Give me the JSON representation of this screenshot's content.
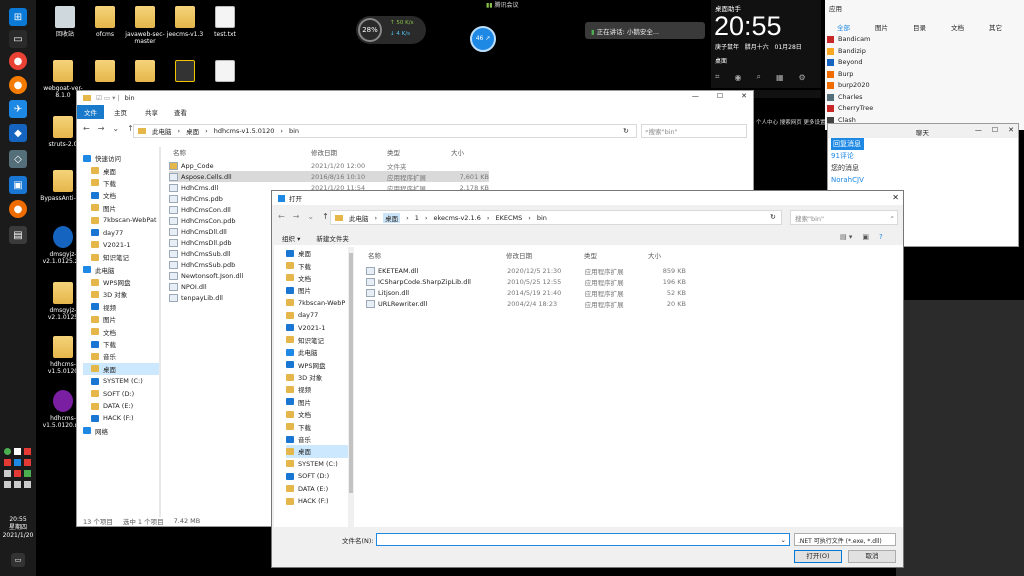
{
  "desktop": {
    "icons": [
      {
        "label": "回收站"
      },
      {
        "label": "ofcms"
      },
      {
        "label": "javaweb-sec-master"
      },
      {
        "label": "jeecms-v1.3"
      },
      {
        "label": "test.txt"
      },
      {
        "label": "webgoat-ver-8.1.0"
      },
      {
        "label": "struts-2.0"
      },
      {
        "label": "BypassAnti-run"
      },
      {
        "label": "dmsgyjz-v2.1.0125.zip"
      },
      {
        "label": "dmsgyjz-v2.1.0125"
      },
      {
        "label": "hdhcms-v1.5.0120"
      },
      {
        "label": "hdhcms-v1.5.0120.rar"
      }
    ]
  },
  "clock_widget": {
    "label": "桌面助手",
    "time": "20:55",
    "weekday": "庚子鼠年",
    "lunar": "腊月十六",
    "date": "01月28日",
    "app_label": "应用",
    "search_label": "设置",
    "desktop_label": "桌面"
  },
  "net_widget": {
    "percent": "28%",
    "up": "50 K/s",
    "down": "4 K/s",
    "badge": "46 ↗"
  },
  "meeting": {
    "label": "腾讯会议"
  },
  "voice": {
    "label": "正在讲话: 小鹅安全..."
  },
  "apps_panel": {
    "title": "应用",
    "tabs": [
      "全部",
      "图片",
      "目录",
      "文档",
      "其它"
    ],
    "items": [
      "Bandicam",
      "Bandizip",
      "Beyond",
      "Burp",
      "burp2020",
      "Charles",
      "CherryTree",
      "Clash"
    ]
  },
  "small_win": {
    "title": "聊天",
    "items": [
      "回复消息",
      "91评论",
      "您的消息",
      "NorahCJV"
    ]
  },
  "status_bar": {
    "hint": "个人中心 搜索网页 更多设置"
  },
  "explorer": {
    "title": "bin",
    "ribbon": [
      "文件",
      "主页",
      "共享",
      "查看"
    ],
    "path": [
      "此电脑",
      "桌面",
      "hdhcms-v1.5.0120",
      "bin"
    ],
    "search_placeholder": "搜索\"bin\"",
    "cols": [
      "名称",
      "修改日期",
      "类型",
      "大小"
    ],
    "tree": [
      "快速访问",
      "桌面",
      "下载",
      "文档",
      "图片",
      "7kbscan-WebPat",
      "day77",
      "V2021-1",
      "知识笔记",
      "此电脑",
      "WPS网盘",
      "3D 对象",
      "视频",
      "图片",
      "文档",
      "下载",
      "音乐",
      "桌面",
      "SYSTEM (C:)",
      "SOFT (D:)",
      "DATA (E:)",
      "HACK (F:)",
      "网络"
    ],
    "files": [
      {
        "name": "App_Code",
        "date": "2021/1/20 12:00",
        "type": "文件夹",
        "size": ""
      },
      {
        "name": "Aspose.Cells.dll",
        "date": "2016/8/16 10:10",
        "type": "应用程序扩展",
        "size": "7,601 KB"
      },
      {
        "name": "HdhCms.dll",
        "date": "2021/1/20 11:54",
        "type": "应用程序扩展",
        "size": "2,178 KB"
      },
      {
        "name": "HdhCms.pdb",
        "date": "",
        "type": "",
        "size": ""
      },
      {
        "name": "HdhCmsCon.dll",
        "date": "",
        "type": "",
        "size": ""
      },
      {
        "name": "HdhCmsCon.pdb",
        "date": "",
        "type": "",
        "size": ""
      },
      {
        "name": "HdhCmsDll.dll",
        "date": "",
        "type": "",
        "size": ""
      },
      {
        "name": "HdhCmsDll.pdb",
        "date": "",
        "type": "",
        "size": ""
      },
      {
        "name": "HdhCmsSub.dll",
        "date": "",
        "type": "",
        "size": ""
      },
      {
        "name": "HdhCmsSub.pdb",
        "date": "",
        "type": "",
        "size": ""
      },
      {
        "name": "Newtonsoft.Json.dll",
        "date": "",
        "type": "",
        "size": ""
      },
      {
        "name": "NPOI.dll",
        "date": "",
        "type": "",
        "size": ""
      },
      {
        "name": "tenpayLib.dll",
        "date": "",
        "type": "",
        "size": ""
      }
    ],
    "status_count": "13 个项目",
    "status_selected": "选中 1 个项目",
    "status_size": "7.42 MB"
  },
  "dialog": {
    "title": "打开",
    "path": [
      "此电脑",
      "桌面",
      "1",
      "ekecms-v2.1.6",
      "EKECMS",
      "bin"
    ],
    "search_placeholder": "搜索\"bin\"",
    "organize": "组织 ▾",
    "new_folder": "新建文件夹",
    "cols": [
      "名称",
      "修改日期",
      "类型",
      "大小"
    ],
    "tree": [
      "桌面",
      "下载",
      "文档",
      "图片",
      "7kbscan-WebP",
      "day77",
      "V2021-1",
      "知识笔记",
      "此电脑",
      "WPS网盘",
      "3D 对象",
      "视频",
      "图片",
      "文档",
      "下载",
      "音乐",
      "桌面",
      "SYSTEM (C:)",
      "SOFT (D:)",
      "DATA (E:)",
      "HACK (F:)"
    ],
    "files": [
      {
        "name": "EKETEAM.dll",
        "date": "2020/12/5 21:30",
        "type": "应用程序扩展",
        "size": "859 KB"
      },
      {
        "name": "ICSharpCode.SharpZipLib.dll",
        "date": "2010/5/25 12:55",
        "type": "应用程序扩展",
        "size": "196 KB"
      },
      {
        "name": "Litjson.dll",
        "date": "2014/5/19 21:40",
        "type": "应用程序扩展",
        "size": "52 KB"
      },
      {
        "name": "URLRewriter.dll",
        "date": "2004/2/4 18:23",
        "type": "应用程序扩展",
        "size": "20 KB"
      }
    ],
    "filename_label": "文件名(N):",
    "filename_value": "",
    "filter": ".NET 可执行文件 (*.exe, *.dll)",
    "open_btn": "打开(O)",
    "cancel_btn": "取消"
  },
  "tray": {
    "time": "20:55",
    "weekday": "星期四",
    "date": "2021/1/20"
  }
}
